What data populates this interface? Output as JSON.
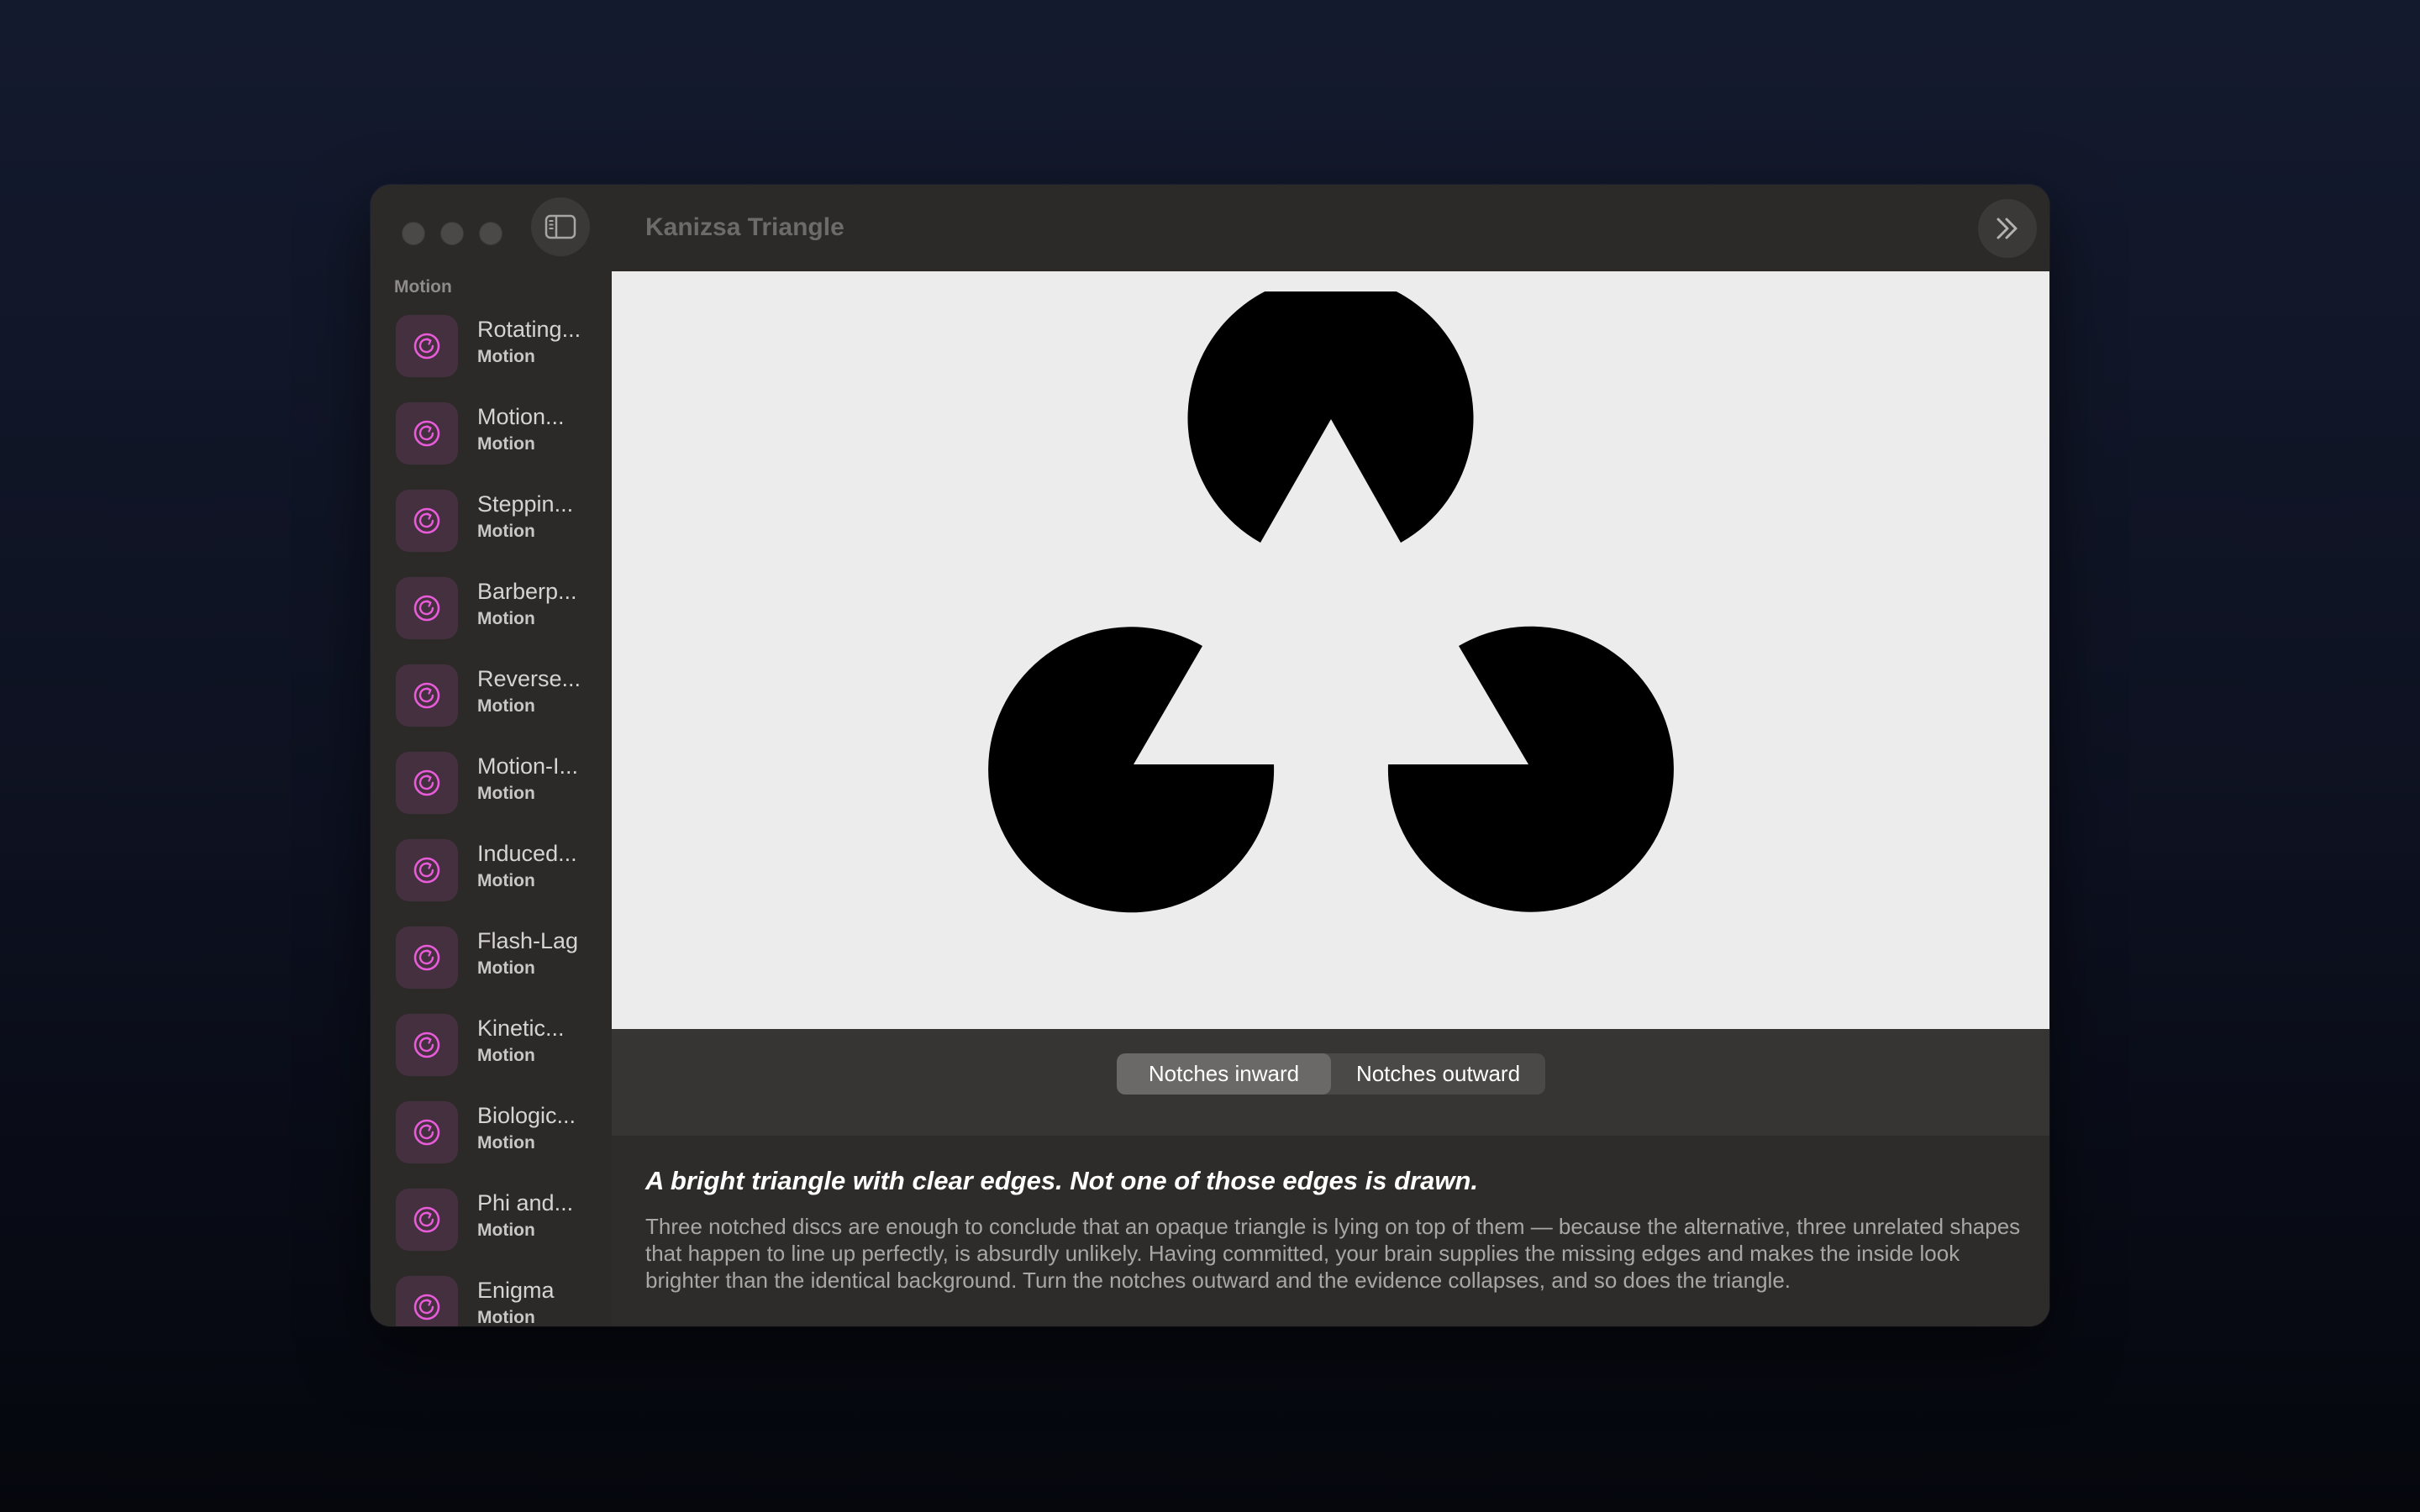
{
  "window": {
    "title": "Kanizsa Triangle"
  },
  "sidebar": {
    "section": "Motion",
    "items": [
      {
        "label": "Rotating...",
        "category": "Motion",
        "icon": "rotate-icon"
      },
      {
        "label": "Motion...",
        "category": "Motion",
        "icon": "rotate-icon"
      },
      {
        "label": "Steppin...",
        "category": "Motion",
        "icon": "rotate-icon"
      },
      {
        "label": "Barberp...",
        "category": "Motion",
        "icon": "rotate-icon"
      },
      {
        "label": "Reverse...",
        "category": "Motion",
        "icon": "rotate-icon"
      },
      {
        "label": "Motion-I...",
        "category": "Motion",
        "icon": "rotate-icon"
      },
      {
        "label": "Induced...",
        "category": "Motion",
        "icon": "rotate-icon"
      },
      {
        "label": "Flash-Lag",
        "category": "Motion",
        "icon": "rotate-icon"
      },
      {
        "label": "Kinetic...",
        "category": "Motion",
        "icon": "rotate-icon"
      },
      {
        "label": "Biologic...",
        "category": "Motion",
        "icon": "rotate-icon"
      },
      {
        "label": "Phi and...",
        "category": "Motion",
        "icon": "rotate-icon"
      },
      {
        "label": "Enigma",
        "category": "Motion",
        "icon": "rotate-icon"
      }
    ]
  },
  "controls": {
    "segments": [
      {
        "label": "Notches inward",
        "selected": true
      },
      {
        "label": "Notches outward",
        "selected": false
      }
    ]
  },
  "description": {
    "headline": "A bright triangle with clear edges. Not one of those edges is drawn.",
    "body": "Three notched discs are enough to conclude that an opaque triangle is lying on top of them — because the alternative, three unrelated shapes that happen to line up perfectly, is absurdly unlikely. Having committed, your brain supplies the missing edges and makes the inside look brighter than the identical background. Turn the notches outward and the evidence collapses, and so does the triangle."
  },
  "colors": {
    "accent": "#e85bd9",
    "canvas_bg": "#ececec",
    "discs": "#000000"
  }
}
